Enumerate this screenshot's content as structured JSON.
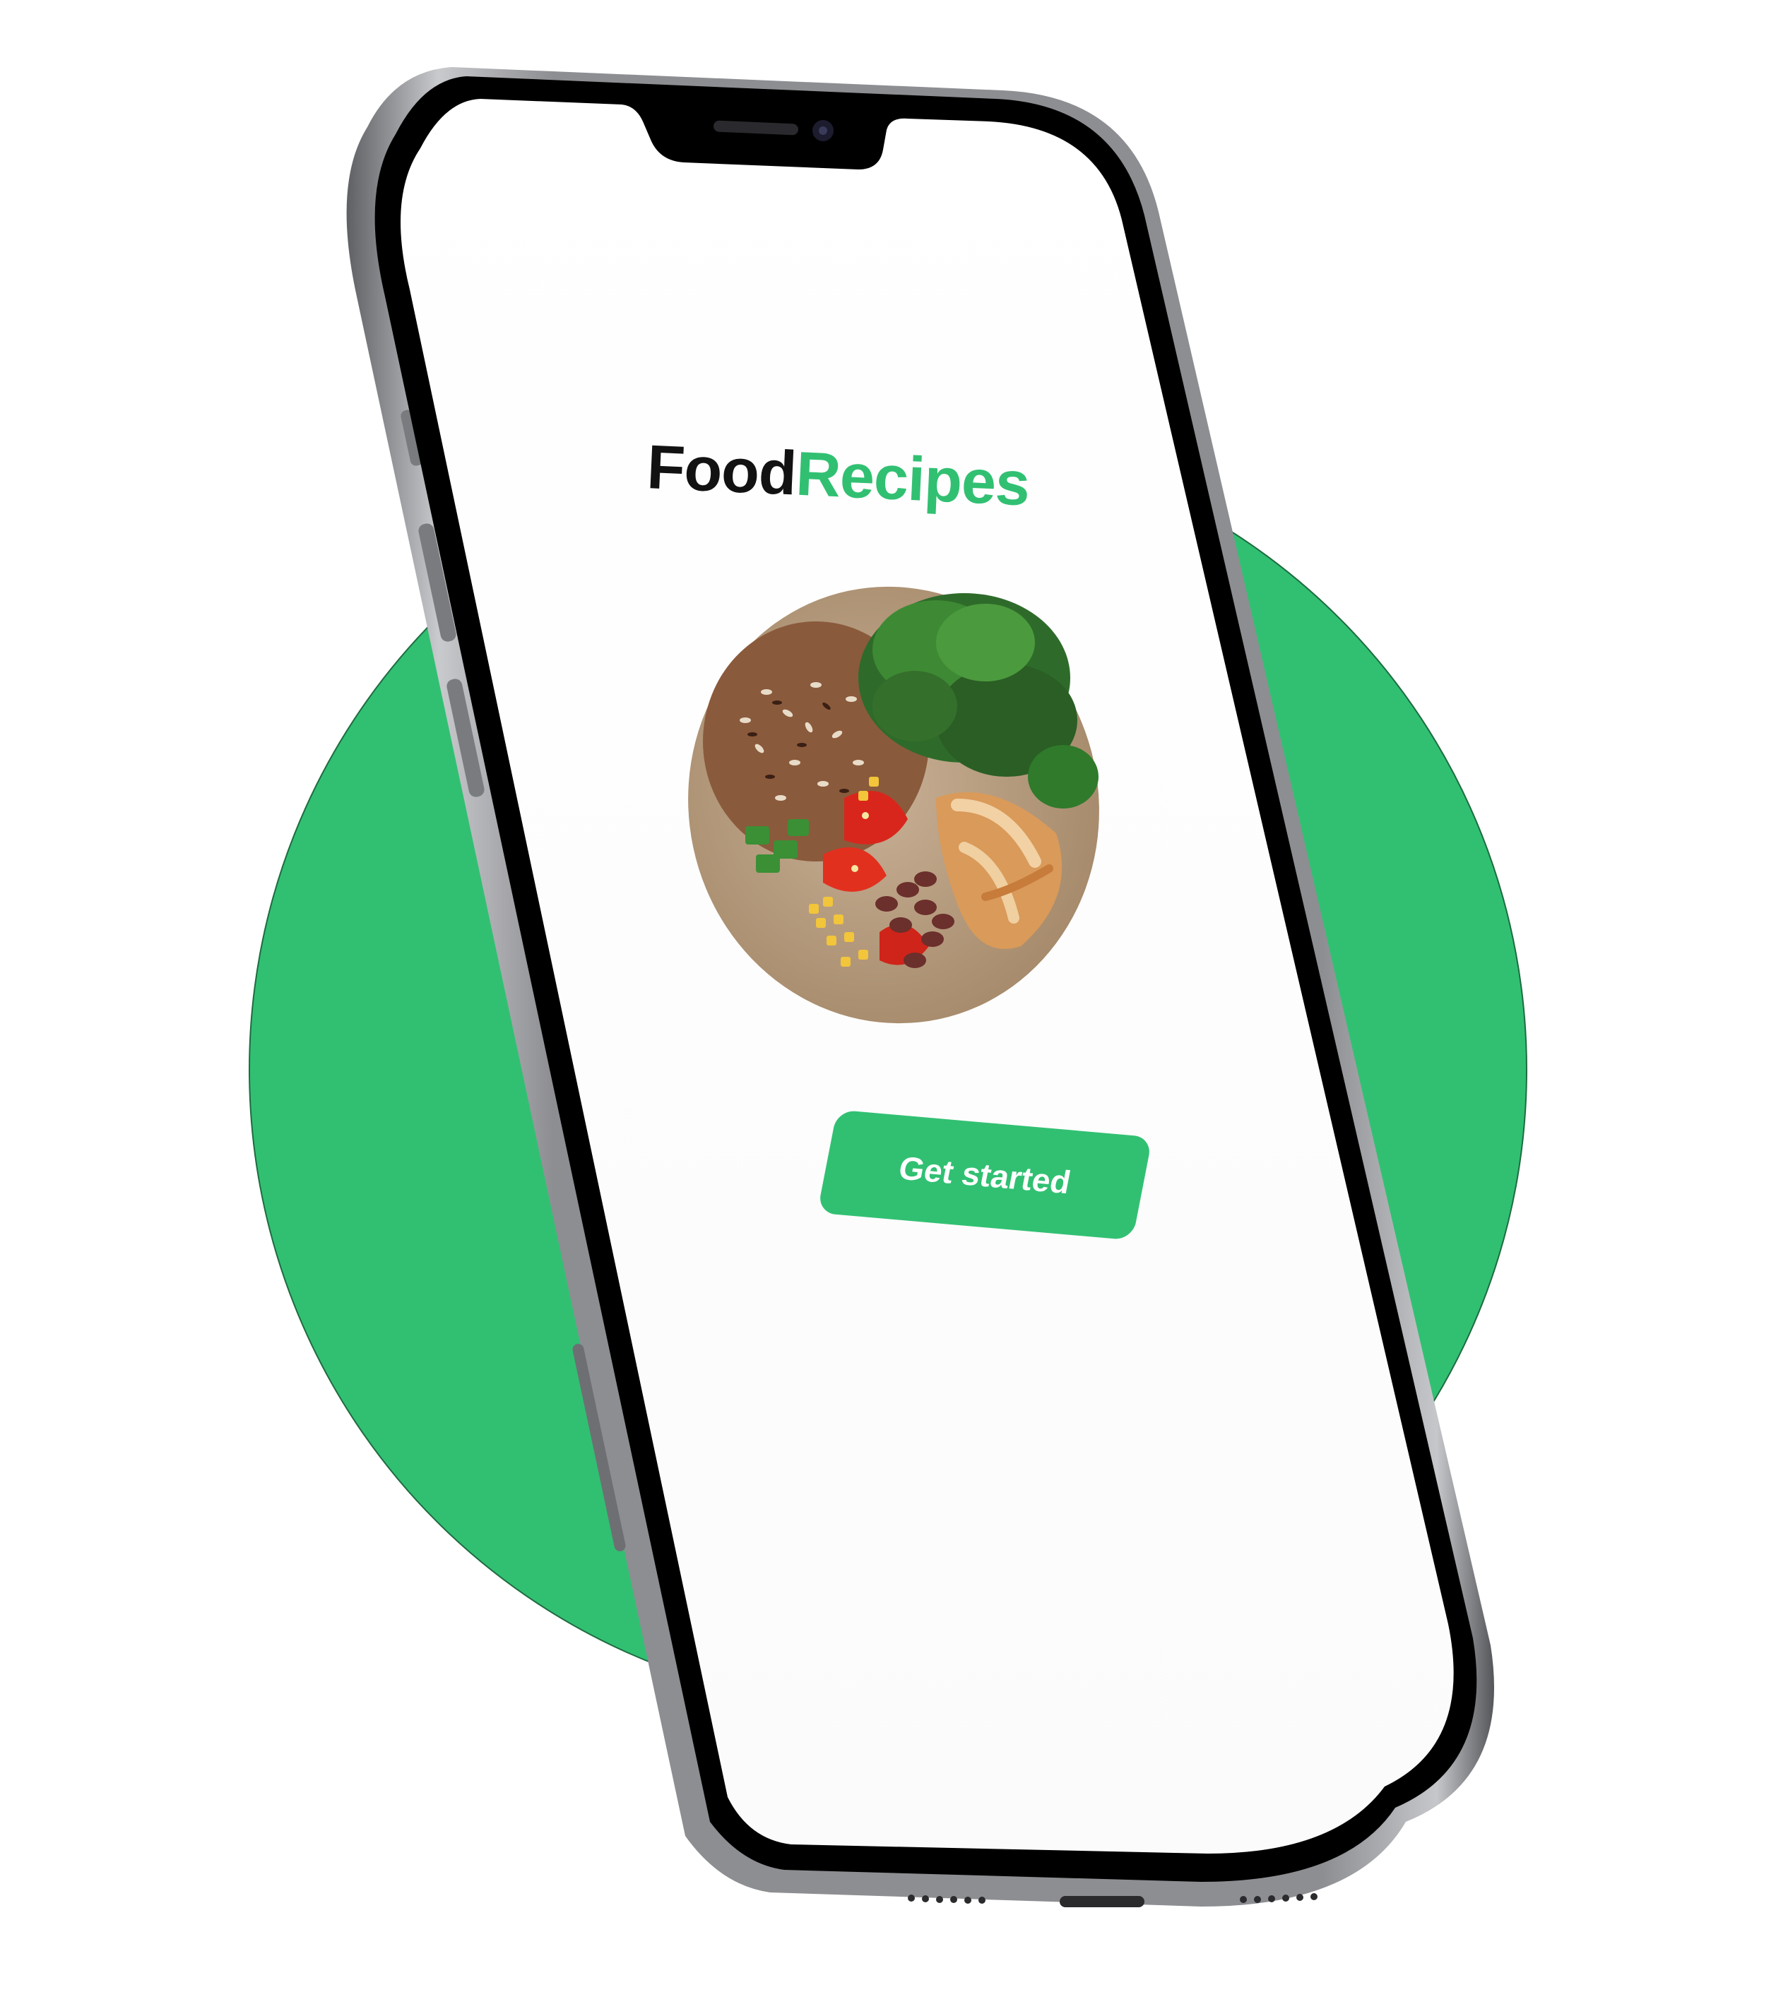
{
  "app": {
    "brand_part1": "Food",
    "brand_part2": "Recipes",
    "cta_label": "Get started"
  },
  "colors": {
    "accent": "#31c072",
    "brand_dark": "#121212",
    "background": "#ffffff",
    "phone_frame": "#8a8b8f",
    "phone_bezel": "#000000"
  },
  "hero_image": {
    "icon": "food-bowl-image"
  }
}
